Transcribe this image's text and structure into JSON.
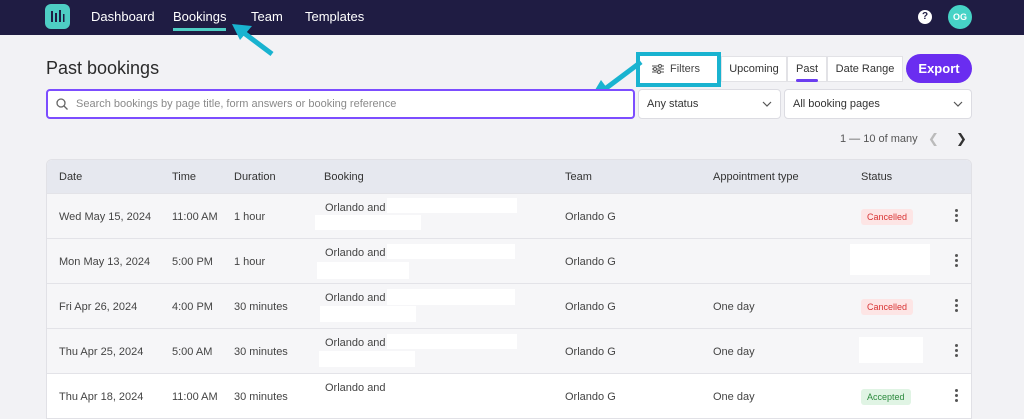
{
  "nav": {
    "items": [
      {
        "label": "Dashboard",
        "active": false
      },
      {
        "label": "Bookings",
        "active": true
      },
      {
        "label": "Team",
        "active": false
      },
      {
        "label": "Templates",
        "active": false
      }
    ],
    "help_label": "?",
    "avatar_initials": "OG"
  },
  "page": {
    "title": "Past bookings"
  },
  "toolbar": {
    "filters_label": "Filters",
    "segments": [
      "Upcoming",
      "Past",
      "Date Range"
    ],
    "active_segment": "Past",
    "export_label": "Export"
  },
  "search": {
    "placeholder": "Search bookings by page title, form answers or booking reference",
    "value": ""
  },
  "status_select": {
    "value": "Any status"
  },
  "pages_select": {
    "value": "All booking pages"
  },
  "pagination": {
    "label": "1 — 10 of many"
  },
  "table": {
    "headers": [
      "Date",
      "Time",
      "Duration",
      "Booking",
      "Team",
      "Appointment type",
      "Status"
    ],
    "rows": [
      {
        "date": "Wed May 15, 2024",
        "time": "11:00 AM",
        "duration": "1 hour",
        "booking": "Orlando and",
        "team": "Orlando G",
        "type": "",
        "status": "Cancelled"
      },
      {
        "date": "Mon May 13, 2024",
        "time": "5:00 PM",
        "duration": "1 hour",
        "booking": "Orlando and",
        "team": "Orlando G",
        "type": "",
        "status": ""
      },
      {
        "date": "Fri Apr 26, 2024",
        "time": "4:00 PM",
        "duration": "30 minutes",
        "booking": "Orlando and",
        "team": "Orlando G",
        "type": "One day",
        "status": "Cancelled"
      },
      {
        "date": "Thu Apr 25, 2024",
        "time": "5:00 AM",
        "duration": "30 minutes",
        "booking": "Orlando and",
        "team": "Orlando G",
        "type": "One day",
        "status": ""
      },
      {
        "date": "Thu Apr 18, 2024",
        "time": "11:00 AM",
        "duration": "30 minutes",
        "booking": "Orlando and",
        "team": "Orlando G",
        "type": "One day",
        "status": "Accepted"
      }
    ]
  },
  "colors": {
    "nav_bg": "#1f1c43",
    "accent": "#6a2df0",
    "teal": "#4ecdc4",
    "highlight": "#19b3d0"
  }
}
